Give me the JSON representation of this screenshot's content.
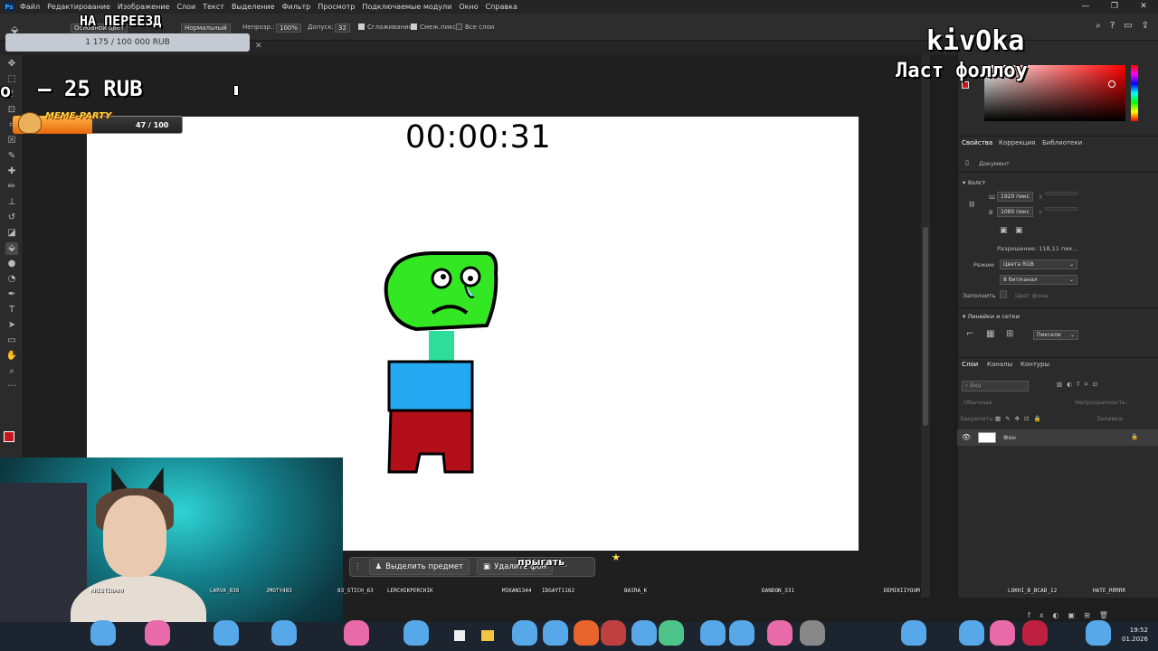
{
  "menu": [
    "Файл",
    "Редактирование",
    "Изображение",
    "Слои",
    "Текст",
    "Выделение",
    "Фильтр",
    "Просмотр",
    "Подключаемые модули",
    "Окно",
    "Справка"
  ],
  "app_logo": "Ps",
  "options": {
    "mode_label": "Основной цвет",
    "blend_value": "Нормальный",
    "opacity_label": "Непрозр.:",
    "opacity_value": "100%",
    "tolerance_label": "Допуск:",
    "tolerance_value": "32",
    "antialias_label": "Сглаживание",
    "contiguous_label": "Смеж.пикс",
    "all_layers_label": "Все слои"
  },
  "overlay": {
    "goal_text": "1 175 / 100 000 RUB",
    "move_text": "НА ПЕРЕЕЗД",
    "rub_text": "— 25 RUB",
    "left_glyph": "о",
    "nick": "kivOka",
    "last_follow": "Ласт фоллоу",
    "meme_title": "MEME-PARTY",
    "meme_count": "47 / 100",
    "meme_progress": 0.47,
    "jump_text": "прыгать"
  },
  "canvas": {
    "timer": "00:00:31"
  },
  "right_panel": {
    "tabs_top": [
      "Свойства",
      "Коррекция",
      "Библиотеки"
    ],
    "doc_label": "Документ",
    "canvas_section": "Холст",
    "width_label": "Ш",
    "width_value": "1920 пикс",
    "height_label": "В",
    "height_value": "1080 пикс",
    "x_label": "X",
    "y_label": "Y",
    "resolution": "Разрешение: 118,11 пик...",
    "mode_label": "Режим",
    "mode_value": "Цвета RGB",
    "depth_value": "8 бит/канал",
    "fill_label": "Заполнить",
    "fill_value": "Цвет фона",
    "rulers_section": "Линейки и сетки",
    "units_value": "Пиксели",
    "layer_tabs": [
      "Слои",
      "Каналы",
      "Контуры"
    ],
    "search_placeholder": "Вид",
    "blend_mode": "Обычные",
    "opacity_label": "Непрозрачность:",
    "lock_label": "Закрепить:",
    "fill_layer_label": "Заливка:",
    "layer_name": "Фон"
  },
  "context_bar": {
    "select_subject": "Выделить предмет",
    "remove_bg": "Удалить фон",
    "more": "···"
  },
  "chat_users": [
    "KRISTINA00",
    "LARVA_838",
    "JMOTY483",
    "83_STICH_63",
    "LERCHIKPERCHIK",
    "MIKAN1344",
    "IDGAYT1162",
    "BAIRA_K",
    "DANDON_331",
    "DEMIKIIYOUM",
    "LOKHI_B_BCAB_12",
    "HATE_RRRRR"
  ],
  "clock": {
    "time": "19:52",
    "date": "01.2026"
  },
  "colors": {
    "fg": "#c4161c",
    "accent": "#31a8ff",
    "canvas_bg": "#ffffff"
  }
}
